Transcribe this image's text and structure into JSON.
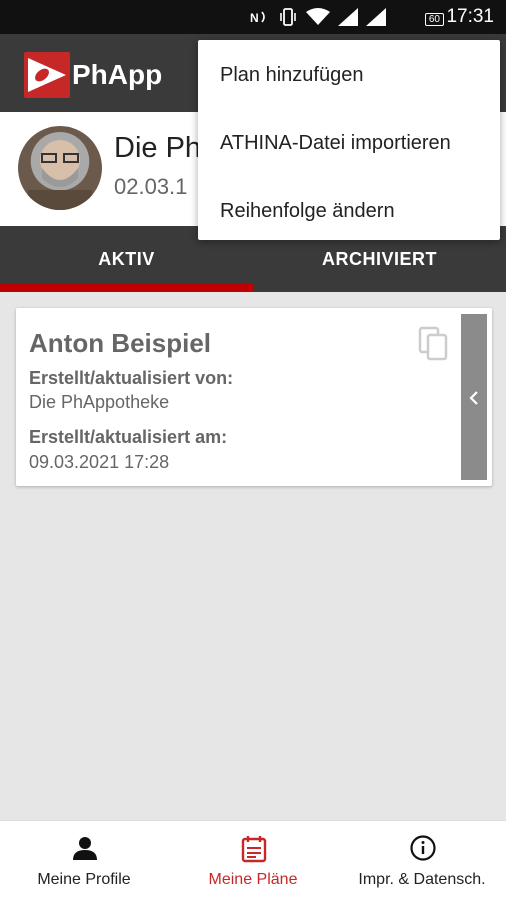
{
  "status_bar": {
    "time": "17:31",
    "battery_percent": "60",
    "icons": [
      "nfc-icon",
      "vibrate-icon",
      "wifi-icon",
      "signal-icon",
      "signal-icon",
      "battery-icon"
    ]
  },
  "app_bar": {
    "app_name": "PhApp"
  },
  "profile": {
    "name": "Die Ph",
    "date": "02.03.1"
  },
  "tabs": [
    {
      "label": "AKTIV",
      "active": true
    },
    {
      "label": "ARCHIVIERT",
      "active": false
    }
  ],
  "plan_card": {
    "name": "Anton Beispiel",
    "created_by_label": "Erstellt/aktualisiert von:",
    "created_by_value": "Die PhAppotheke",
    "created_at_label": "Erstellt/aktualisiert am:",
    "created_at_value": "09.03.2021 17:28"
  },
  "overflow_menu": {
    "items": [
      "Plan hinzufügen",
      "ATHINA-Datei importieren",
      "Reihenfolge ändern"
    ]
  },
  "bottom_nav": {
    "items": [
      {
        "label": "Meine Profile",
        "icon": "person-icon",
        "active": false
      },
      {
        "label": "Meine Pläne",
        "icon": "calendar-list-icon",
        "active": true
      },
      {
        "label": "Impr. & Datensch.",
        "icon": "info-icon",
        "active": false
      }
    ]
  },
  "colors": {
    "accent": "#c62828",
    "appbar": "#3a3a3a",
    "background": "#e6e6e6"
  }
}
